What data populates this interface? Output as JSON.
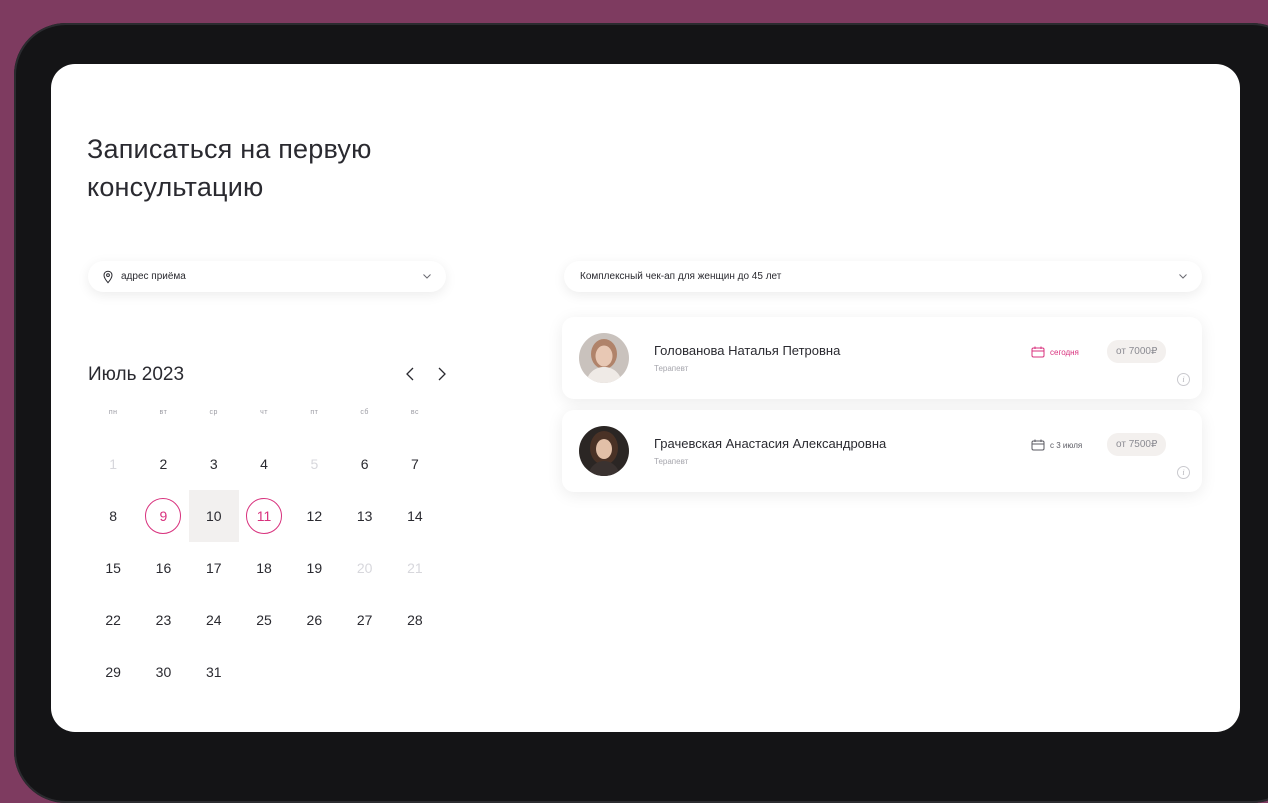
{
  "page": {
    "title": "Записаться на первую консультацию"
  },
  "filters": {
    "address_placeholder": "адрес приёма",
    "service_selected": "Комплексный чек-ап для женщин до 45 лет"
  },
  "calendar": {
    "month_label": "Июль 2023",
    "weekdays": [
      "пн",
      "вт",
      "ср",
      "чт",
      "пт",
      "сб",
      "вс"
    ],
    "days": [
      {
        "n": "1",
        "state": "muted"
      },
      {
        "n": "2",
        "state": ""
      },
      {
        "n": "3",
        "state": ""
      },
      {
        "n": "4",
        "state": ""
      },
      {
        "n": "5",
        "state": "muted"
      },
      {
        "n": "6",
        "state": ""
      },
      {
        "n": "7",
        "state": ""
      },
      {
        "n": "8",
        "state": ""
      },
      {
        "n": "9",
        "state": "ring"
      },
      {
        "n": "10",
        "state": "range"
      },
      {
        "n": "11",
        "state": "ring"
      },
      {
        "n": "12",
        "state": ""
      },
      {
        "n": "13",
        "state": ""
      },
      {
        "n": "14",
        "state": ""
      },
      {
        "n": "15",
        "state": ""
      },
      {
        "n": "16",
        "state": ""
      },
      {
        "n": "17",
        "state": ""
      },
      {
        "n": "18",
        "state": ""
      },
      {
        "n": "19",
        "state": ""
      },
      {
        "n": "20",
        "state": "muted"
      },
      {
        "n": "21",
        "state": "muted"
      },
      {
        "n": "22",
        "state": ""
      },
      {
        "n": "23",
        "state": ""
      },
      {
        "n": "24",
        "state": ""
      },
      {
        "n": "25",
        "state": ""
      },
      {
        "n": "26",
        "state": ""
      },
      {
        "n": "27",
        "state": ""
      },
      {
        "n": "28",
        "state": ""
      },
      {
        "n": "29",
        "state": ""
      },
      {
        "n": "30",
        "state": ""
      },
      {
        "n": "31",
        "state": ""
      }
    ]
  },
  "doctors": [
    {
      "name": "Голованова Наталья Петровна",
      "role": "Терапевт",
      "availability": "сегодня",
      "price": "от 7000₽"
    },
    {
      "name": "Грачевская Анастасия Александровна",
      "role": "Терапевт",
      "availability": "с 3 июля",
      "price": "от 7500₽"
    }
  ],
  "icons": {
    "location": "location-pin-icon",
    "chevron": "chevron-down-icon",
    "calendar": "calendar-icon",
    "info": "info-icon"
  },
  "colors": {
    "accent": "#d8317d",
    "background": "#7e3b60",
    "price_pill": "#f3f0ee"
  }
}
